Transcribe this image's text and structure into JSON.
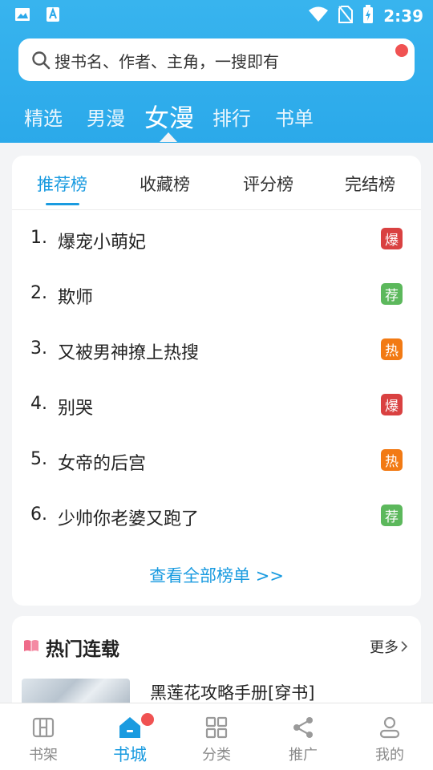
{
  "status_bar": {
    "time": "2:39",
    "left_icons": [
      "image-icon",
      "font-app-icon"
    ],
    "right_icons": [
      "wifi-icon",
      "no-sim-icon",
      "battery-charging-icon"
    ]
  },
  "search": {
    "placeholder": "搜书名、作者、主角，一搜即有"
  },
  "categories": [
    {
      "label": "精选",
      "active": false
    },
    {
      "label": "男漫",
      "active": false
    },
    {
      "label": "女漫",
      "active": true
    },
    {
      "label": "排行",
      "active": false
    },
    {
      "label": "书单",
      "active": false
    }
  ],
  "rank_tabs": [
    {
      "label": "推荐榜",
      "active": true
    },
    {
      "label": "收藏榜",
      "active": false
    },
    {
      "label": "评分榜",
      "active": false
    },
    {
      "label": "完结榜",
      "active": false
    }
  ],
  "rank_list": [
    {
      "num": "1.",
      "title": "爆宠小萌妃",
      "badge": "爆",
      "badge_color": "#d94141"
    },
    {
      "num": "2.",
      "title": "欺师",
      "badge": "荐",
      "badge_color": "#5cb85c"
    },
    {
      "num": "3.",
      "title": "又被男神撩上热搜",
      "badge": "热",
      "badge_color": "#f27a14"
    },
    {
      "num": "4.",
      "title": "别哭",
      "badge": "爆",
      "badge_color": "#d94141"
    },
    {
      "num": "5.",
      "title": "女帝的后宫",
      "badge": "热",
      "badge_color": "#f27a14"
    },
    {
      "num": "6.",
      "title": "少帅你老婆又跑了",
      "badge": "荐",
      "badge_color": "#5cb85c"
    }
  ],
  "view_all_label": "查看全部榜单 >>",
  "hot_section": {
    "title": "热门连载",
    "more_label": "更多",
    "book_title": "黑莲花攻略手册[穿书]"
  },
  "bottom_nav": [
    {
      "label": "书架",
      "icon": "bookshelf-icon",
      "active": false
    },
    {
      "label": "书城",
      "icon": "home-icon",
      "active": true
    },
    {
      "label": "分类",
      "icon": "grid-icon",
      "active": false
    },
    {
      "label": "推广",
      "icon": "share-icon",
      "active": false
    },
    {
      "label": "我的",
      "icon": "user-icon",
      "active": false
    }
  ],
  "colors": {
    "primary": "#1a9be0",
    "header_bg": "#2ba9ea",
    "notification_dot": "#f05252",
    "background": "#f3f4f6"
  }
}
